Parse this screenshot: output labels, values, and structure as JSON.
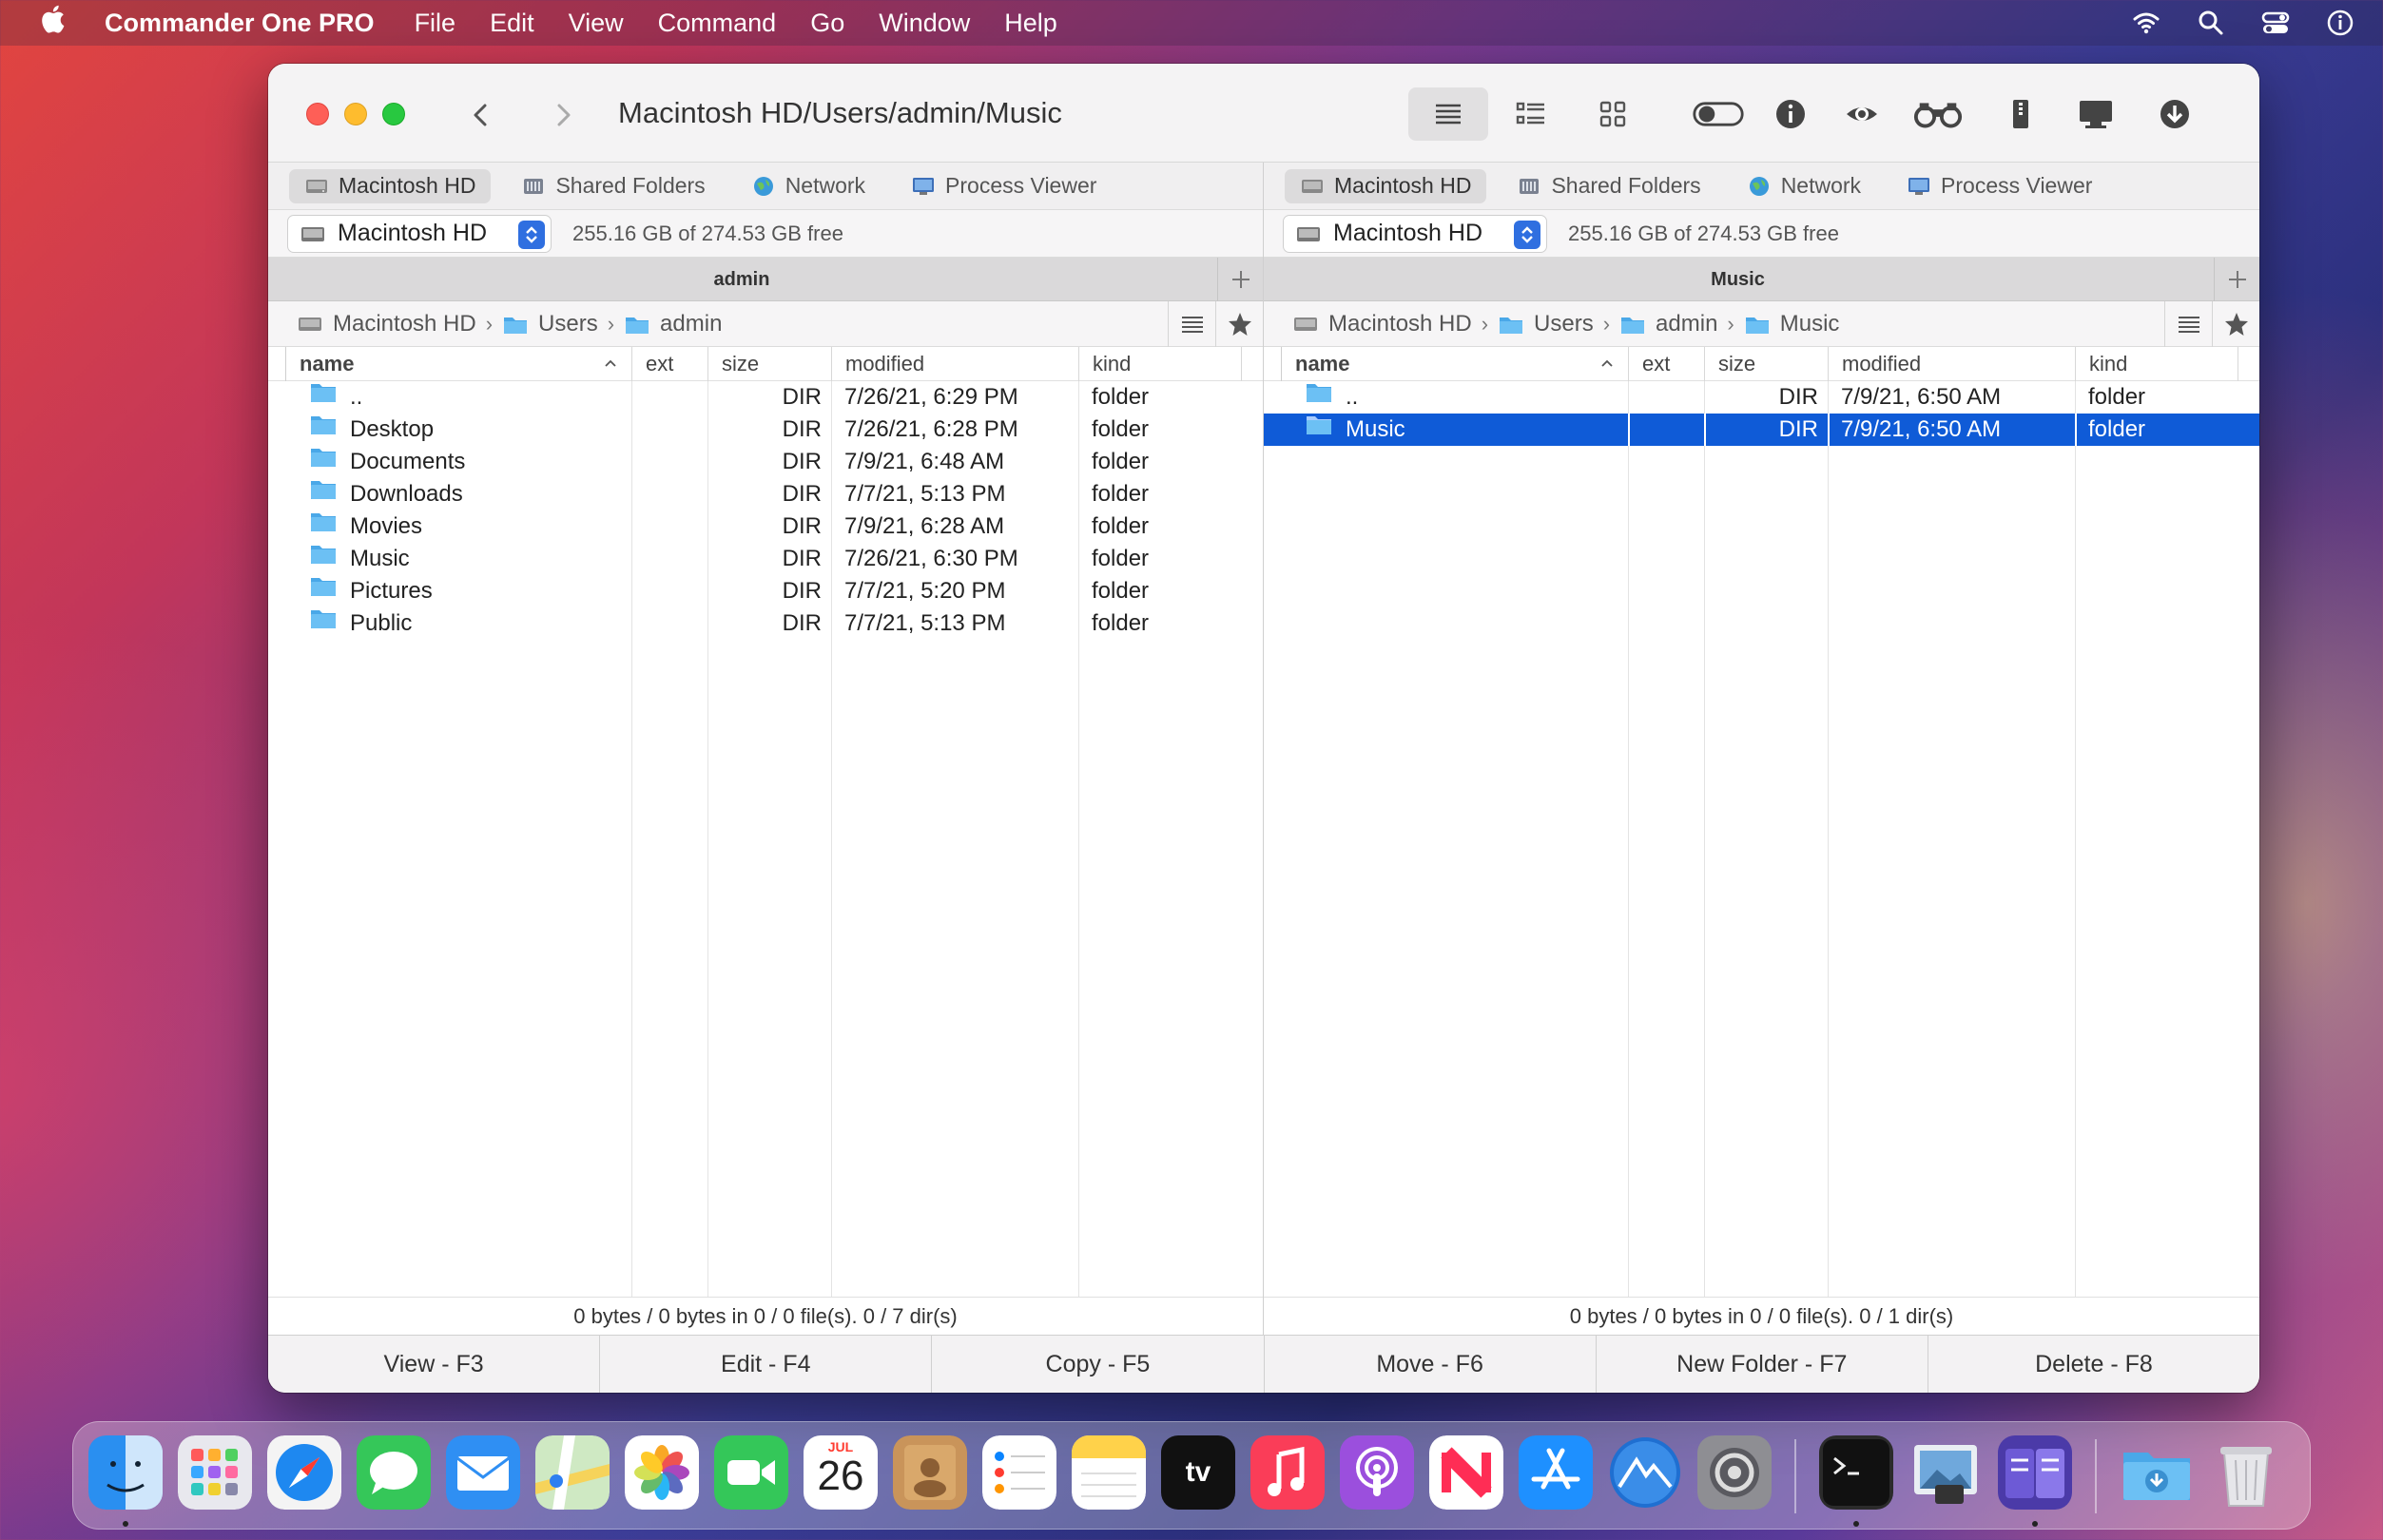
{
  "menubar": {
    "app_name": "Commander One PRO",
    "items": [
      "File",
      "Edit",
      "View",
      "Command",
      "Go",
      "Window",
      "Help"
    ]
  },
  "window": {
    "path_title": "Macintosh HD/Users/admin/Music"
  },
  "left_panel": {
    "tabs": [
      "Macintosh HD",
      "Shared Folders",
      "Network",
      "Process Viewer"
    ],
    "drive": "Macintosh HD",
    "free_space": "255.16 GB of 274.53 GB free",
    "header_title": "admin",
    "breadcrumbs": [
      "Macintosh HD",
      "Users",
      "admin"
    ],
    "columns": [
      "name",
      "ext",
      "size",
      "modified",
      "kind"
    ],
    "rows": [
      {
        "name": "..",
        "ext": "",
        "size": "DIR",
        "modified": "7/26/21, 6:29 PM",
        "kind": "folder"
      },
      {
        "name": "Desktop",
        "ext": "",
        "size": "DIR",
        "modified": "7/26/21, 6:28 PM",
        "kind": "folder"
      },
      {
        "name": "Documents",
        "ext": "",
        "size": "DIR",
        "modified": "7/9/21, 6:48 AM",
        "kind": "folder"
      },
      {
        "name": "Downloads",
        "ext": "",
        "size": "DIR",
        "modified": "7/7/21, 5:13 PM",
        "kind": "folder"
      },
      {
        "name": "Movies",
        "ext": "",
        "size": "DIR",
        "modified": "7/9/21, 6:28 AM",
        "kind": "folder"
      },
      {
        "name": "Music",
        "ext": "",
        "size": "DIR",
        "modified": "7/26/21, 6:30 PM",
        "kind": "folder"
      },
      {
        "name": "Pictures",
        "ext": "",
        "size": "DIR",
        "modified": "7/7/21, 5:20 PM",
        "kind": "folder"
      },
      {
        "name": "Public",
        "ext": "",
        "size": "DIR",
        "modified": "7/7/21, 5:13 PM",
        "kind": "folder"
      }
    ],
    "status": "0 bytes / 0 bytes in 0 / 0 file(s). 0 / 7 dir(s)"
  },
  "right_panel": {
    "tabs": [
      "Macintosh HD",
      "Shared Folders",
      "Network",
      "Process Viewer"
    ],
    "drive": "Macintosh HD",
    "free_space": "255.16 GB of 274.53 GB free",
    "header_title": "Music",
    "breadcrumbs": [
      "Macintosh HD",
      "Users",
      "admin",
      "Music"
    ],
    "columns": [
      "name",
      "ext",
      "size",
      "modified",
      "kind"
    ],
    "rows": [
      {
        "name": "..",
        "ext": "",
        "size": "DIR",
        "modified": "7/9/21, 6:50 AM",
        "kind": "folder"
      },
      {
        "name": "Music",
        "ext": "",
        "size": "DIR",
        "modified": "7/9/21, 6:50 AM",
        "kind": "folder"
      }
    ],
    "selected_row": 1,
    "status": "0 bytes / 0 bytes in 0 / 0 file(s). 0 / 1 dir(s)"
  },
  "function_keys": [
    "View - F3",
    "Edit - F4",
    "Copy - F5",
    "Move - F6",
    "New Folder - F7",
    "Delete - F8"
  ],
  "dock": {
    "calendar_month": "JUL",
    "calendar_day": "26",
    "tv_label": "tv"
  },
  "colors": {
    "selection": "#0f5bd7",
    "folder": "#4aa8e8",
    "accent": "#2f6fe0"
  }
}
